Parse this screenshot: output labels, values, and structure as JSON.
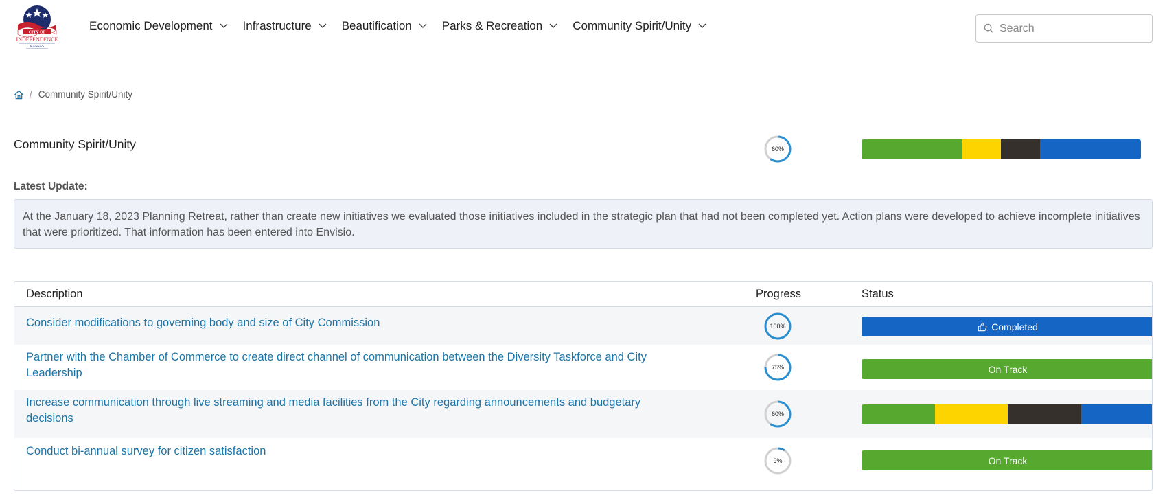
{
  "logo": {
    "text_line1": "CITY OF",
    "text_line2": "INDEPENDENCE",
    "text_line3": "KANSAS"
  },
  "nav": {
    "items": [
      {
        "label": "Economic Development",
        "icon": "chevron-down-icon"
      },
      {
        "label": "Infrastructure",
        "icon": "chevron-down-icon"
      },
      {
        "label": "Beautification",
        "icon": "chevron-down-icon"
      },
      {
        "label": "Parks & Recreation",
        "icon": "chevron-down-icon"
      },
      {
        "label": "Community Spirit/Unity",
        "icon": "chevron-down-icon"
      }
    ]
  },
  "search": {
    "placeholder": "Search",
    "value": "",
    "icon": "search-icon"
  },
  "breadcrumb": {
    "home_icon": "home-icon",
    "separator": "/",
    "current": "Community Spirit/Unity"
  },
  "summary": {
    "title": "Community Spirit/Unity",
    "progress_text": "60%",
    "progress_value": 60,
    "status_segments": [
      {
        "color": "#56a92e",
        "fraction": 0.36
      },
      {
        "color": "#fdd300",
        "fraction": 0.14
      },
      {
        "color": "#36302c",
        "fraction": 0.14
      },
      {
        "color": "#1565c4",
        "fraction": 0.36
      }
    ]
  },
  "latest_update": {
    "label": "Latest Update:",
    "text": "At the January 18, 2023 Planning Retreat, rather than create new initiatives we evaluated those initiatives included in the strategic plan that had not been completed yet. Action plans were developed to achieve incomplete initiatives that were prioritized. That information has been entered into Envisio."
  },
  "table": {
    "headers": {
      "description": "Description",
      "progress": "Progress",
      "status": "Status"
    },
    "rows": [
      {
        "description": "Consider modifications to governing body and size of City Commission",
        "progress_text": "100%",
        "progress_value": 100,
        "status": "Completed",
        "status_type": "completed",
        "status_icon": "thumbs-up-icon"
      },
      {
        "description": "Partner with the Chamber of Commerce to create direct channel of communication between the Diversity Taskforce and City Leadership",
        "progress_text": "75%",
        "progress_value": 75,
        "status": "On Track",
        "status_type": "ontrack"
      },
      {
        "description": "Increase communication through live streaming and media facilities from the City regarding announcements and budgetary decisions",
        "progress_text": "60%",
        "progress_value": 60,
        "status": "",
        "status_type": "mixed",
        "status_segments": [
          {
            "color": "#56a92e",
            "fraction": 0.25
          },
          {
            "color": "#fdd300",
            "fraction": 0.25
          },
          {
            "color": "#36302c",
            "fraction": 0.25
          },
          {
            "color": "#1565c4",
            "fraction": 0.25
          }
        ]
      },
      {
        "description": "Conduct bi-annual survey for citizen satisfaction",
        "progress_text": "9%",
        "progress_value": 9,
        "status": "On Track",
        "status_type": "ontrack"
      }
    ]
  },
  "colors": {
    "link": "#1c75a8",
    "ring": "#2a8fcf",
    "ring_track": "#d0d0d0",
    "completed": "#1565c4",
    "on_track": "#56a92e"
  }
}
